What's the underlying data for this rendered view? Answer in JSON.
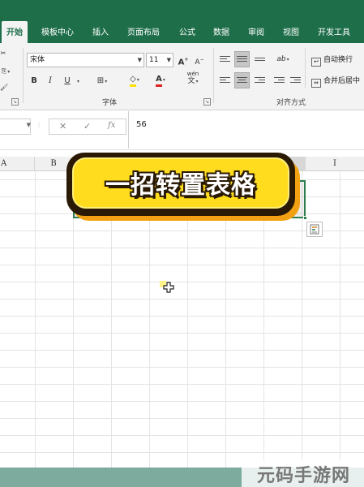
{
  "tabs": [
    {
      "label": "开始",
      "active": true
    },
    {
      "label": "模板中心",
      "active": false
    },
    {
      "label": "插入",
      "active": false
    },
    {
      "label": "页面布局",
      "active": false
    },
    {
      "label": "公式",
      "active": false
    },
    {
      "label": "数据",
      "active": false
    },
    {
      "label": "审阅",
      "active": false
    },
    {
      "label": "视图",
      "active": false
    },
    {
      "label": "开发工具",
      "active": false
    }
  ],
  "ribbon": {
    "font_name": "宋体",
    "font_size": "11",
    "grow_font": "A",
    "shrink_font": "A",
    "bold": "B",
    "italic": "I",
    "underline": "U",
    "font_color_glyph": "A",
    "phonetic": "wén",
    "font_group_label": "字体",
    "align_group_label": "对齐方式",
    "wrap_text": "自动换行",
    "merge_center": "合并后居中",
    "orientation": "ab"
  },
  "formula_bar": {
    "name_box": "",
    "cancel_symbol": "✕",
    "enter_symbol": "✓",
    "fx_symbol": "fx",
    "value": "56"
  },
  "columns": [
    "A",
    "B",
    "",
    "",
    "",
    "",
    "",
    "",
    "I"
  ],
  "banner": {
    "title": "一招转置表格"
  },
  "watermark": "元码手游网",
  "colors": {
    "tab_bar": "#1e6e4a",
    "selection": "#2e7d4f",
    "banner_fill": "#ffdc1e",
    "banner_shadow": "#f3a112"
  }
}
